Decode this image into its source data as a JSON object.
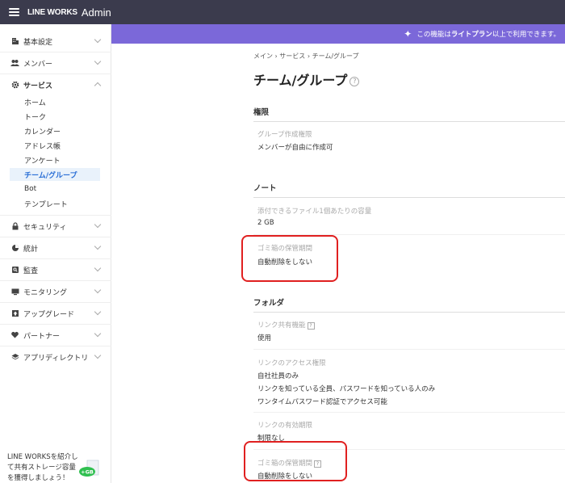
{
  "header": {
    "brand": "LINE WORKS",
    "product": "Admin"
  },
  "sidebar": {
    "items": [
      {
        "label": "基本設定",
        "icon": "building-icon"
      },
      {
        "label": "メンバー",
        "icon": "users-icon"
      },
      {
        "label": "サービス",
        "icon": "gear-icon"
      },
      {
        "label": "セキュリティ",
        "icon": "lock-icon"
      },
      {
        "label": "統計",
        "icon": "pie-chart-icon"
      },
      {
        "label": "監査",
        "icon": "audit-icon"
      },
      {
        "label": "モニタリング",
        "icon": "monitor-icon"
      },
      {
        "label": "アップグレード",
        "icon": "upgrade-icon"
      },
      {
        "label": "パートナー",
        "icon": "heart-hands-icon"
      },
      {
        "label": "アプリディレクトリ",
        "icon": "layers-icon"
      }
    ],
    "sub_items": [
      "ホーム",
      "トーク",
      "カレンダー",
      "アドレス帳",
      "アンケート",
      "チーム/グループ",
      "Bot",
      "テンプレート"
    ],
    "promo": {
      "line1": "LINE WORKSを紹介し",
      "line2": "て共有ストレージ容量",
      "line3": "を獲得しましょう！",
      "badge": "+GB"
    }
  },
  "banner": {
    "prefix": "この機能は",
    "plan": "ライトプラン",
    "suffix": " 以上で利用できます。"
  },
  "main": {
    "breadcrumb": "メイン › サービス › チーム/グループ",
    "title": "チーム/グループ",
    "help": "?",
    "sections": {
      "permissions": {
        "title": "権限",
        "rows": [
          {
            "label": "グループ作成権限",
            "value": "メンバーが自由に作成可"
          }
        ]
      },
      "note": {
        "title": "ノート",
        "rows": [
          {
            "label": "添付できるファイル1個あたりの容量",
            "value": "2 GB"
          },
          {
            "label": "ゴミ箱の保管期間",
            "value": "自動削除をしない"
          }
        ]
      },
      "folder": {
        "title": "フォルダ",
        "rows": [
          {
            "label": "リンク共有機能",
            "value": "使用"
          },
          {
            "label": "リンクのアクセス権限",
            "values": [
              "自社社員のみ",
              "リンクを知っている全員、パスワードを知っている人のみ",
              "ワンタイムパスワード認証でアクセス可能"
            ]
          },
          {
            "label": "リンクの有効期限",
            "value": "制限なし"
          },
          {
            "label": "ゴミ箱の保管期間",
            "value": "自動削除をしない"
          }
        ]
      }
    }
  },
  "colors": {
    "header_bg": "#3b3b4d",
    "banner_bg": "#7b68d9",
    "active_text": "#2a6fd6",
    "highlight": "#e02020"
  }
}
